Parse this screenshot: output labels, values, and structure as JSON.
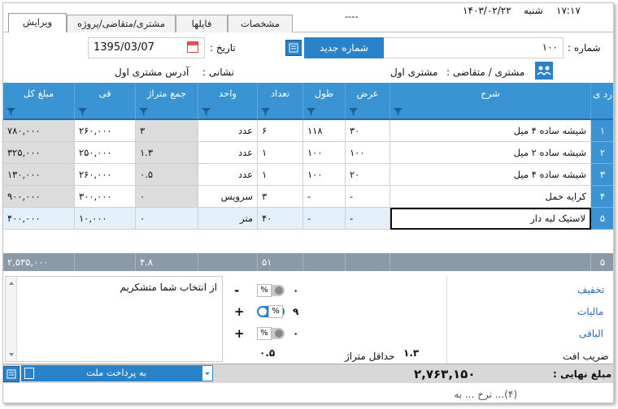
{
  "tabs": [
    "ویرایش",
    "مشتری/متقاضی/پروژه",
    "فایلها",
    "مشخصات",
    "----"
  ],
  "header": {
    "time": "۱۷:۱۷",
    "weekday": "شنبه",
    "date": "۱۴۰۳/۰۲/۲۲"
  },
  "form": {
    "number_label": "شماره :",
    "number_value": "۱۰۰",
    "new_number_button": "شماره جدید",
    "date_label": "تاریخ :",
    "date_value": "1395/03/07",
    "customer_label": "مشتری / متقاضی :",
    "customer_value": "مشتری اول",
    "address_label": "نشانی :",
    "address_value": "آدرس مشتری اول"
  },
  "columns": [
    "رد ی",
    "شرح",
    "عرض",
    "طول",
    "تعداد",
    "واحد",
    "جمع متراژ",
    "فی",
    "مبلغ کل"
  ],
  "rows": [
    {
      "n": "۱",
      "desc": "شیشه ساده ۴ میل",
      "w": "۳۰",
      "l": "۱۱۸",
      "qty": "۶",
      "unit": "عدد",
      "area": "۳",
      "price": "۲۶۰,۰۰۰",
      "total": "۷۸۰,۰۰۰"
    },
    {
      "n": "۲",
      "desc": "شیشه ساده ۲ میل",
      "w": "۱۰۰",
      "l": "۱۰۰",
      "qty": "۱",
      "unit": "عدد",
      "area": "۱.۳",
      "price": "۲۵۰,۰۰۰",
      "total": "۳۲۵,۰۰۰"
    },
    {
      "n": "۳",
      "desc": "شیشه ساده ۴ میل",
      "w": "۲۰",
      "l": "۱۰۰",
      "qty": "۱",
      "unit": "عدد",
      "area": "۰.۵",
      "price": "۲۶۰,۰۰۰",
      "total": "۱۳۰,۰۰۰"
    },
    {
      "n": "۴",
      "desc": "کرایه حمل",
      "w": "-",
      "l": "-",
      "qty": "۳",
      "unit": "سرویس",
      "area": "۰",
      "price": "۳۰۰,۰۰۰",
      "total": "۹۰۰,۰۰۰"
    },
    {
      "n": "۵",
      "desc": "لاستیک لبه دار",
      "w": "-",
      "l": "-",
      "qty": "۴۰",
      "unit": "متر",
      "area": "۰",
      "price": "۱۰,۰۰۰",
      "total": "۴۰۰,۰۰۰"
    }
  ],
  "summary": {
    "count": "۵",
    "qty_total": "۵۱",
    "area_total": "۴.۸",
    "sum_total": "۲,۵۳۵,۰۰۰"
  },
  "notes": "از انتخاب شما متشکریم",
  "adjustments": [
    {
      "label": "تخفیف",
      "sign": "-",
      "value": "۰",
      "on": false
    },
    {
      "label": "مالیات",
      "sign": "+",
      "value": "۹",
      "on": true
    },
    {
      "label": "الباقی",
      "sign": "+",
      "value": "۰",
      "on": false
    }
  ],
  "waste_label": "ضریب افت",
  "waste_value": "۰.۵",
  "min_area_label": "حداقل متراژ",
  "min_area_value": "۱.۳",
  "final_label": "مبلغ نهایی :",
  "final_value": "۲,۷۶۳,۱۵۰",
  "pay_label": "به پرداخت ملت",
  "footer_partial": "(۴)... نرخ ... به",
  "colors": {
    "accent": "#3a94d4",
    "summary": "#8a9aa6"
  }
}
